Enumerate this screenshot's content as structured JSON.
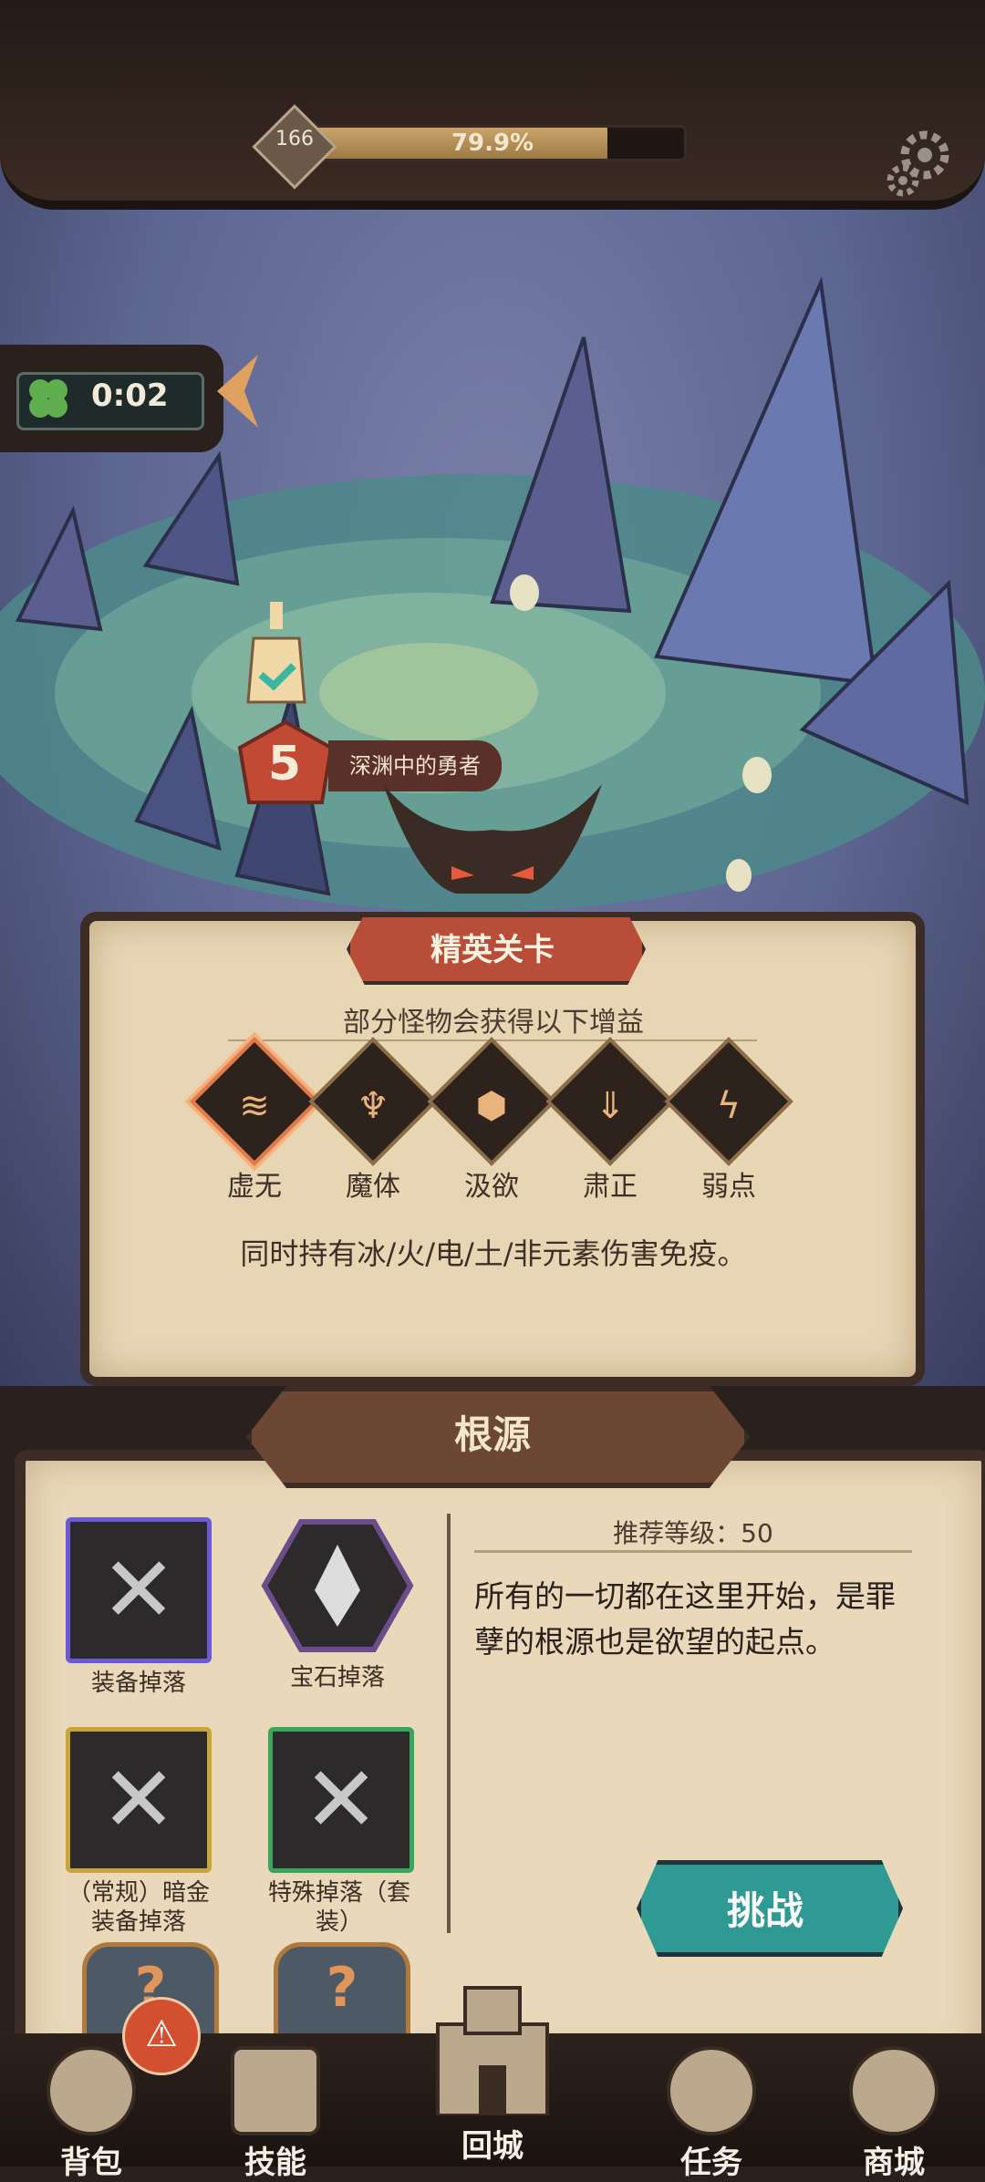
{
  "hud": {
    "level": "166",
    "progress_text": "79.9%",
    "progress_fraction": 0.799,
    "timer": "0:02"
  },
  "stage": {
    "number": "5",
    "name": "深渊中的勇者"
  },
  "elite": {
    "title": "精英关卡",
    "subtitle": "部分怪物会获得以下增益",
    "buffs": [
      {
        "label": "虚无",
        "icon": "void-icon",
        "selected": true
      },
      {
        "label": "魔体",
        "icon": "demon-body-icon",
        "selected": false
      },
      {
        "label": "汲欲",
        "icon": "drain-desire-icon",
        "selected": false
      },
      {
        "label": "肃正",
        "icon": "purge-icon",
        "selected": false
      },
      {
        "label": "弱点",
        "icon": "weakness-icon",
        "selected": false
      }
    ],
    "immunity_text": "同时持有冰/火/电/土/非元素伤害免疫。"
  },
  "root": {
    "title": "根源",
    "recommend_level": "推荐等级：50",
    "description": "所有的一切都在这里开始，是罪孽的根源也是欲望的起点。",
    "loot": [
      {
        "label": "装备掉落",
        "color": "#6a5ad6"
      },
      {
        "label": "宝石掉落",
        "color": "#6b4d8c"
      },
      {
        "label": "（常规）暗金装备掉落",
        "color": "#c9a43c"
      },
      {
        "label": "特殊掉落（套装）",
        "color": "#3aa65a"
      }
    ],
    "challenge_label": "挑战"
  },
  "nav": {
    "items": [
      {
        "label": "背包",
        "icon": "backpack-icon"
      },
      {
        "label": "技能",
        "icon": "skill-icon"
      },
      {
        "label": "回城",
        "icon": "castle-icon"
      },
      {
        "label": "任务",
        "icon": "quest-scroll-icon"
      },
      {
        "label": "商城",
        "icon": "shop-crown-icon"
      }
    ],
    "badge_glyph": "⚠"
  }
}
